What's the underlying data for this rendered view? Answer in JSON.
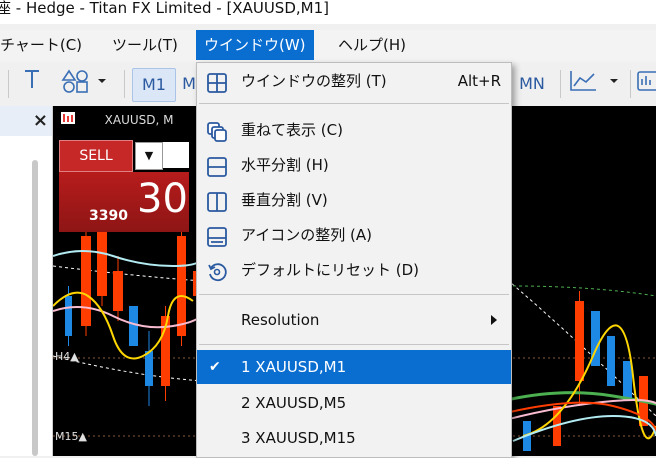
{
  "window": {
    "title": "座 - Hedge - Titan FX Limited - [XAUUSD,M1]"
  },
  "menubar": {
    "items": [
      {
        "label": "チャート(C)"
      },
      {
        "label": "ツール(T)"
      },
      {
        "label": "ウインドウ(W)",
        "active": true
      },
      {
        "label": "ヘルプ(H)"
      }
    ]
  },
  "toolbar": {
    "timeframes": [
      "M1",
      "M",
      "MN"
    ],
    "icons": [
      "cursor-text-icon",
      "shapes-icon",
      "line-chart-icon",
      "chart-window-icon"
    ]
  },
  "left_panel": {
    "close_label": "×"
  },
  "chart": {
    "tab_title": "XAUUSD, M",
    "sell_label": "SELL",
    "price_small": "3390",
    "price_big": "30",
    "h4_label": "H4▲",
    "m15_label": "M15▲",
    "colors": {
      "background": "#000000",
      "bull": "#1e88e5",
      "bear": "#ff3d00",
      "ma_yellow": "#ffd600",
      "ma_green": "#4caf50",
      "ma_pink": "#f8bbd0",
      "ma_cyan": "#b2ebf2"
    }
  },
  "dropdown": {
    "items": [
      {
        "icon": "tile-windows-icon",
        "label": "ウインドウの整列 (T)",
        "shortcut": "Alt+R"
      },
      {
        "icon": "cascade-icon",
        "label": "重ねて表示 (C)"
      },
      {
        "icon": "tile-horizontal-icon",
        "label": "水平分割 (H)"
      },
      {
        "icon": "tile-vertical-icon",
        "label": "垂直分割 (V)"
      },
      {
        "icon": "arrange-icons-icon",
        "label": "アイコンの整列 (A)"
      },
      {
        "icon": "reset-icon",
        "label": "デフォルトにリセット (D)"
      },
      {
        "label": "Resolution",
        "submenu": true
      },
      {
        "label": "1 XAUUSD,M1",
        "checked": true,
        "selected": true
      },
      {
        "label": "2 XAUUSD,M5"
      },
      {
        "label": "3 XAUUSD,M15"
      }
    ]
  }
}
